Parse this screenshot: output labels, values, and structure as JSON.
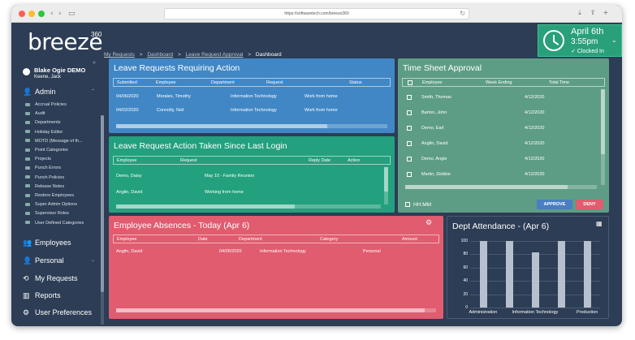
{
  "browser": {
    "url": "https://softwaretech.com/breeze360"
  },
  "logo": {
    "text": "breeze",
    "number": "360"
  },
  "breadcrumb": {
    "items": [
      "My Requests",
      "Dashboard",
      "Leave Request Approval",
      "Dashboard"
    ],
    "separator": ">"
  },
  "clock": {
    "date": "April 6th",
    "time": "3:55pm",
    "status": "✓ Clocked In"
  },
  "user": {
    "name": "Blake Ogie DEMO",
    "sub": "Keene, Jack"
  },
  "sidebar": {
    "admin_label": "Admin",
    "admin_items": [
      "Accrual Policies",
      "Audit",
      "Departments",
      "Holiday Editor",
      "MOTD (Message of th...",
      "Point Categories",
      "Projects",
      "Punch Errors",
      "Punch Policies",
      "Release Notes",
      "Restore Employees",
      "Super Admin Options",
      "Supervisor Roles",
      "User Defined Categories"
    ],
    "employees_label": "Employees",
    "personal_label": "Personal",
    "my_requests_label": "My Requests",
    "reports_label": "Reports",
    "user_prefs_label": "User Preferences"
  },
  "leave_requests": {
    "title": "Leave Requests Requiring Action",
    "columns": [
      "Submitted",
      "Employee",
      "Department",
      "Request",
      "Status"
    ],
    "rows": [
      [
        "04/06/2020",
        "Morales, Timothy",
        "Information Technology",
        "Work from home",
        ""
      ],
      [
        "04/02/2020",
        "Connolly, Neil",
        "Information Technology",
        "Work from home",
        ""
      ]
    ],
    "color": "#4187c5"
  },
  "leave_actions": {
    "title": "Leave Request Action Taken Since Last Login",
    "columns": [
      "Employee",
      "Request",
      "Reply Date",
      "Action"
    ],
    "rows": [
      [
        "Demo, Daisy",
        "May 10 - Family Reunion",
        "",
        ""
      ],
      [
        "Anglin, David",
        "Working from home",
        "",
        ""
      ]
    ],
    "color": "#23a07d"
  },
  "timesheet": {
    "title": "Time Sheet Approval",
    "columns": [
      "Employee",
      "Week Ending",
      "Total Time"
    ],
    "rows": [
      [
        "Smith, Thomas",
        "4/12/2020",
        ""
      ],
      [
        "Barton, John",
        "4/12/2020",
        ""
      ],
      [
        "Demo, Earl",
        "4/12/2020",
        ""
      ],
      [
        "Anglin, David",
        "4/12/2020",
        ""
      ],
      [
        "Demo, Angie",
        "4/12/2020",
        ""
      ],
      [
        "Martin, Debbie",
        "4/12/2020",
        ""
      ]
    ],
    "hhmm_label": "HH:MM",
    "approve_label": "APPROVE",
    "deny_label": "DENY",
    "color": "#5e9d85"
  },
  "absences": {
    "title": "Employee Absences - Today (Apr 6)",
    "columns": [
      "Employee",
      "Date",
      "Department",
      "Category",
      "Amount"
    ],
    "rows": [
      [
        "Anglin, David",
        "04/06/2020",
        "Information Technology",
        "Personal",
        ""
      ]
    ],
    "color": "#e05c6e"
  },
  "dept_attendance": {
    "title": "Dept Attendance - (Apr 6)",
    "color": "#2c3d55"
  },
  "chart_data": {
    "type": "bar",
    "categories": [
      "Administration",
      "",
      "Information Technology",
      "",
      "Production"
    ],
    "values": [
      100,
      100,
      83,
      100,
      100
    ],
    "yticks": [
      0,
      20,
      40,
      60,
      80,
      100
    ],
    "ylim": [
      0,
      100
    ],
    "bar_color": "#b7c0cf"
  }
}
